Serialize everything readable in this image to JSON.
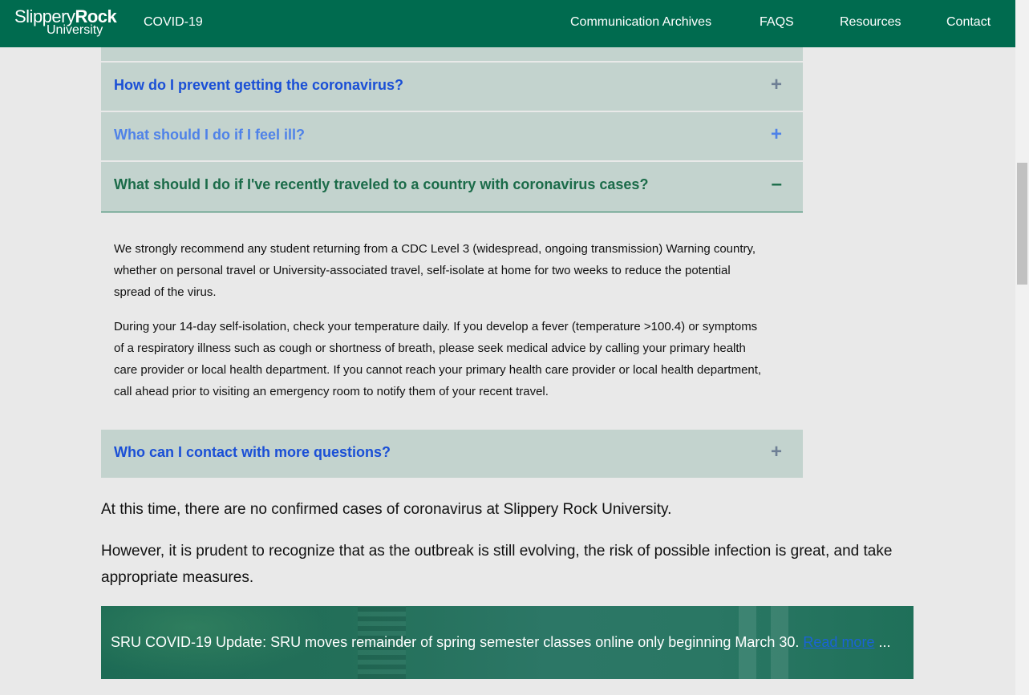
{
  "header": {
    "logo": {
      "line1_thin": "Slippery",
      "line1_bold": "Rock",
      "line2": "University"
    },
    "site_title": "COVID-19",
    "nav": [
      "Communication Archives",
      "FAQS",
      "Resources",
      "Contact"
    ]
  },
  "faq": {
    "items": [
      {
        "question": "How do I prevent getting the coronavirus?",
        "toggle": "+"
      },
      {
        "question": "What should I do if I feel ill?",
        "toggle": "+"
      },
      {
        "question": "What should I do if I've recently traveled to a country with coronavirus cases?",
        "toggle": "–"
      },
      {
        "question": "Who can I contact with more questions?",
        "toggle": "+"
      }
    ],
    "answer": [
      "We strongly recommend any student returning from a CDC Level 3 (widespread, ongoing transmission) Warning country, whether on personal travel or University-associated travel, self-isolate at home for two weeks to reduce the potential spread of the virus.",
      "During your 14-day self-isolation, check your temperature daily. If you develop a fever (temperature >100.4) or symptoms of a respiratory illness such as cough or shortness of breath, please seek medical advice by calling your primary health care provider or local health department. If you cannot reach your primary health care provider or local health department, call ahead prior to visiting an emergency room to notify them of your recent travel."
    ]
  },
  "body": {
    "para1": "At this time, there are no confirmed cases of coronavirus at Slippery Rock University.",
    "para2": "However, it is prudent to recognize that as the outbreak is still evolving, the risk of possible infection is great, and take appropriate measures."
  },
  "banner": {
    "text": "SRU COVID-19 Update: SRU moves remainder of spring semester classes online only beginning March 30.",
    "link": "Read more",
    "ellipsis": " ..."
  }
}
